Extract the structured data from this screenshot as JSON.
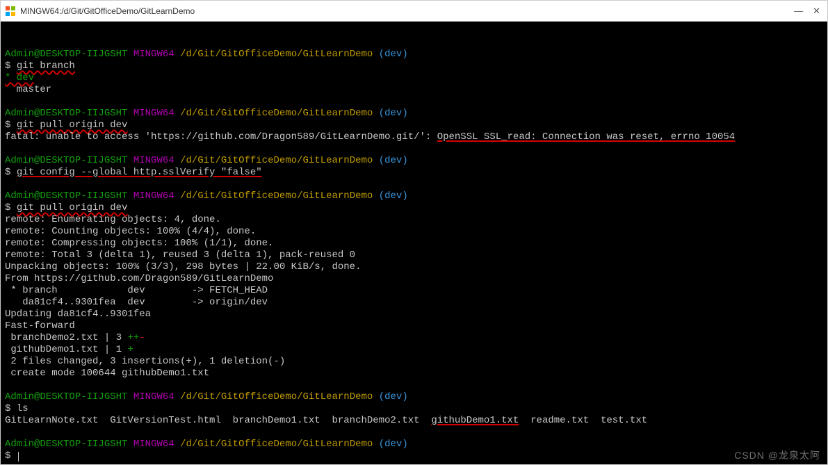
{
  "window": {
    "title": "MINGW64:/d/Git/GitOfficeDemo/GitLearnDemo",
    "min": "—",
    "close": "✕"
  },
  "prompt": {
    "userHost": "Admin@DESKTOP-IIJGSHT",
    "shell": "MINGW64",
    "path": "/d/Git/GitOfficeDemo/GitLearnDemo",
    "branch": "(dev)",
    "sigil": "$"
  },
  "cmds": {
    "c1": "git branch",
    "c1_out1": "* dev",
    "c1_out2": "  master",
    "c2": "git pull origin dev",
    "c2_fatal_pre": "fatal: unable to access 'https://github.com/Dragon589/GitLearnDemo.git/': ",
    "c2_fatal_err": "OpenSSL SSL_read: Connection was reset, errno 10054",
    "c3": "git config --global http.sslVerify \"false\"",
    "c4": "git pull origin dev",
    "c4_lines": [
      "remote: Enumerating objects: 4, done.",
      "remote: Counting objects: 100% (4/4), done.",
      "remote: Compressing objects: 100% (1/1), done.",
      "remote: Total 3 (delta 1), reused 3 (delta 1), pack-reused 0",
      "Unpacking objects: 100% (3/3), 298 bytes | 22.00 KiB/s, done.",
      "From https://github.com/Dragon589/GitLearnDemo",
      " * branch            dev        -> FETCH_HEAD",
      "   da81cf4..9301fea  dev        -> origin/dev",
      "Updating da81cf4..9301fea",
      "Fast-forward"
    ],
    "c4_diff1_file": " branchDemo2.txt | 3 ",
    "c4_diff1_plus": "++",
    "c4_diff1_minus": "-",
    "c4_diff2_file": " githubDemo1.txt | 1 ",
    "c4_diff2_plus": "+",
    "c4_summary": " 2 files changed, 3 insertions(+), 1 deletion(-)",
    "c4_create": " create mode 100644 githubDemo1.txt",
    "c5": "ls",
    "ls_pre": "GitLearnNote.txt  GitVersionTest.html  branchDemo1.txt  branchDemo2.txt  ",
    "ls_hl": "githubDemo1.txt",
    "ls_post": "  readme.txt  test.txt"
  },
  "watermark": "CSDN @龙泉太阿"
}
